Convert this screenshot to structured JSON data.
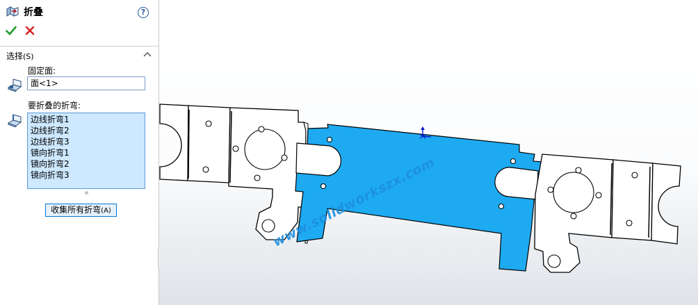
{
  "panel": {
    "title": "折叠",
    "help_symbol": "?",
    "section": {
      "title": "选择",
      "accel": "(S)"
    },
    "fixed_face": {
      "label": "固定面:",
      "value": "面<1>"
    },
    "bends": {
      "label": "要折叠的折弯:",
      "items": [
        "边线折弯1",
        "边线折弯2",
        "边线折弯3",
        "镜向折弯1",
        "镜向折弯2",
        "镜向折弯3"
      ]
    },
    "collect_button": {
      "label": "收集所有折弯",
      "accel": "(A)"
    }
  },
  "viewport": {
    "watermark": "www.solidworkszx.com",
    "selected_face_color": "#1eaaf1",
    "part_color": "#ffffff"
  }
}
